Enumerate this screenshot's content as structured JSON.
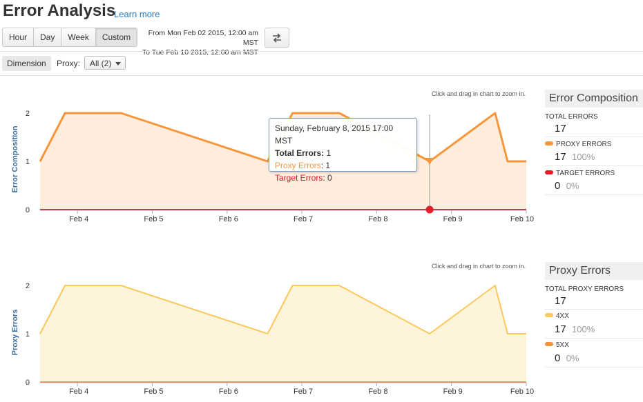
{
  "header": {
    "title": "Error Analysis",
    "learn_more": "Learn more"
  },
  "range_buttons": [
    "Hour",
    "Day",
    "Week",
    "Custom"
  ],
  "date_range": {
    "from_label": "From",
    "from": "Mon Feb 02 2015, 12:00 am MST",
    "to_label": "To",
    "to": "Tue Feb 10 2015, 12:00 am MST"
  },
  "filters": {
    "dimension_label": "Dimension",
    "proxy_label": "Proxy:",
    "proxy_value": "All (2)"
  },
  "zoom_hint": "Click and drag in chart to zoom in.",
  "tooltip": {
    "date": "Sunday, February 8, 2015 17:00 MST",
    "total_label": "Total Errors",
    "total_value": "1",
    "proxy_label": "Proxy Errors",
    "proxy_value": "1",
    "target_label": "Target Errors",
    "target_value": "0"
  },
  "composition": {
    "title": "Error Composition",
    "total_label": "TOTAL ERRORS",
    "total_value": "17",
    "proxy_label": "PROXY ERRORS",
    "proxy_value": "17",
    "proxy_pct": "100%",
    "target_label": "TARGET ERRORS",
    "target_value": "0",
    "target_pct": "0%"
  },
  "proxy_errors": {
    "title": "Proxy Errors",
    "total_label": "TOTAL PROXY ERRORS",
    "total_value": "17",
    "s4xx_label": "4XX",
    "s4xx_value": "17",
    "s4xx_pct": "100%",
    "s5xx_label": "5XX",
    "s5xx_value": "0",
    "s5xx_pct": "0%"
  },
  "colors": {
    "proxy": "#f7963b",
    "target": "#e02020",
    "fourxx": "#fbc95b",
    "fivexx": "#f5923e",
    "link": "#2a7ab8",
    "axis_title": "#3d6e9e"
  },
  "chart_data": [
    {
      "type": "area",
      "ylabel": "Error Composition",
      "x_ticks": [
        "Feb 4",
        "Feb 5",
        "Feb 6",
        "Feb 7",
        "Feb 8",
        "Feb 9",
        "Feb 10"
      ],
      "y_ticks": [
        0,
        1,
        2
      ],
      "ylim": [
        0,
        2.2
      ],
      "xlim": [
        "2015-02-03 12:00",
        "2015-02-10 00:00"
      ],
      "series": [
        {
          "name": "Proxy Errors",
          "x": [
            "2015-02-03 12:00",
            "2015-02-03 20:00",
            "2015-02-04 14:00",
            "2015-02-06 13:00",
            "2015-02-06 21:00",
            "2015-02-07 12:00",
            "2015-02-08 17:00",
            "2015-02-09 14:00",
            "2015-02-09 18:00",
            "2015-02-10 00:00"
          ],
          "values": [
            1,
            2,
            2,
            1,
            2,
            2,
            1,
            2,
            1,
            1
          ]
        },
        {
          "name": "Target Errors",
          "x": [
            "2015-02-03 12:00",
            "2015-02-10 00:00"
          ],
          "values": [
            0,
            0
          ]
        }
      ]
    },
    {
      "type": "area",
      "ylabel": "Proxy Errors",
      "x_ticks": [
        "Feb 4",
        "Feb 5",
        "Feb 6",
        "Feb 7",
        "Feb 8",
        "Feb 9",
        "Feb 10"
      ],
      "y_ticks": [
        0,
        1,
        2
      ],
      "ylim": [
        0,
        2.2
      ],
      "xlim": [
        "2015-02-03 12:00",
        "2015-02-10 00:00"
      ],
      "series": [
        {
          "name": "4XX",
          "x": [
            "2015-02-03 12:00",
            "2015-02-03 20:00",
            "2015-02-04 14:00",
            "2015-02-06 13:00",
            "2015-02-06 21:00",
            "2015-02-07 12:00",
            "2015-02-08 17:00",
            "2015-02-09 14:00",
            "2015-02-09 18:00",
            "2015-02-10 00:00"
          ],
          "values": [
            1,
            2,
            2,
            1,
            2,
            2,
            1,
            2,
            1,
            1
          ]
        },
        {
          "name": "5XX",
          "x": [
            "2015-02-03 12:00",
            "2015-02-10 00:00"
          ],
          "values": [
            0,
            0
          ]
        }
      ]
    }
  ]
}
